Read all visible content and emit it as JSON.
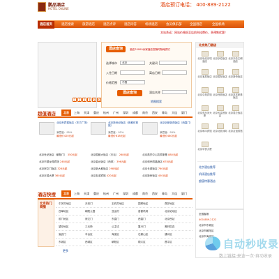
{
  "header": {
    "logo_name": "鹏品酒店",
    "logo_en": "HOTEL ONLINE",
    "hotline": "酒店预订电话：  400-889-2122"
  },
  "nav": {
    "items": [
      "酒店首页",
      "酒店搜索",
      "旅游酒店",
      "酒店点评",
      "酒店问答",
      "机场酒店",
      "会员俱乐部",
      "全国酒店",
      "全国机场"
    ]
  },
  "notice": "本站承诺：网站价格低至店前台挂牌价，多预售优惠！",
  "search": {
    "tab": "酒店查询",
    "slogan": "酒店70000余家酒店您随时随地预订",
    "city_label": "选择城市",
    "city_value": "北京",
    "keyword_label": "关键词",
    "checkin_label": "入住日期",
    "checkout_label": "离店日期",
    "price_label": "价格范围",
    "price_value": "不限",
    "name_label": "酒店名称",
    "button": "酒店查询",
    "map_link": "地图搜索"
  },
  "thumbs": [
    "1",
    "2",
    "3",
    "4",
    "5",
    "6"
  ],
  "sidebar": {
    "title": "北京热门酒店",
    "hotels": [
      "北京世纪京瑞酒店",
      "北京京伦饭店",
      "北京天伦王朝酒店",
      "北京宝辰饭店",
      "北京国际饭店",
      "北京新侨饭店",
      "北京中苑宾馆",
      "北京西苑饭店",
      "北京凯宾斯基饭店",
      "北京亮马河大厦",
      "北京长富宫饭店",
      "北京昆仑饭店",
      "北京和平宾馆",
      "北京北辰洲际",
      "北京友谊宾馆",
      "北京华侨大厦"
    ],
    "links": [
      "北京酒店推荐",
      "机场酒店推荐",
      "超值特惠酒店"
    ]
  },
  "hot": {
    "title": "超值酒店",
    "cities": [
      "北京",
      "上海",
      "天津",
      "重庆",
      "杭州",
      "广州",
      "深圳",
      "成都",
      "南京",
      "西安",
      "青岛",
      "大连",
      "厦门",
      "苏州"
    ],
    "cards": [
      {
        "name": "北京贵宾楼饭店（东方广场）",
        "score": "满意度：95%",
        "price": "最低价420元起"
      },
      {
        "name": "北京新世纪饭店（首都体育馆）",
        "score": "满意度：92%",
        "price": "最低价618元起"
      },
      {
        "name": "北京京都信苑饭店（西直门）",
        "score": "满意度：93%",
        "price": "最低价480元起"
      }
    ],
    "lists": [
      {
        "name": "北京世纪饭店（朝阳门）",
        "price": "350元起"
      },
      {
        "name": "北京国都大饭店（天坛）",
        "price": "268元起"
      },
      {
        "name": "北京燕莎中心凯宾斯基",
        "price": "880元起"
      },
      {
        "name": "北京市银龙苑宾馆",
        "price": "248元起"
      },
      {
        "name": "北京金台饭店（西单）",
        "price": "396元起"
      },
      {
        "name": "北京和乔丽晶酒店",
        "price": "678元起"
      },
      {
        "name": "北京崇文门饭店",
        "price": "328元起"
      },
      {
        "name": "北京新大都饭店",
        "price": "298元起"
      },
      {
        "name": "北京长城饭店",
        "price": "760元起"
      },
      {
        "name": "北京京瑞大厦",
        "price": "360元起"
      },
      {
        "name": "北京友谊宾馆",
        "price": "420元起"
      },
      {
        "name": "北京新侨饭店",
        "price": "450元起"
      }
    ]
  },
  "quick": {
    "title": "酒店快搜",
    "left_header": "北京热门商圈",
    "rows": [
      [
        "中关村地区",
        "天安门",
        "王府井地区",
        "国贸地区",
        "燕莎地区"
      ],
      [
        "西单地区",
        "朝阳公园",
        "亚运村",
        "首都机场",
        "北京站地区"
      ],
      [
        "前门地区",
        "崇文门",
        "东直门",
        "西直门",
        "北京西站"
      ],
      [
        "望京地区",
        "三元桥",
        "公主坟",
        "复兴门",
        "奥林匹克"
      ],
      [
        "宣武门",
        "丰台区",
        "海淀区",
        "石景山区",
        "通州区"
      ],
      [
        "东城区",
        "西城区",
        "朝阳区",
        "顺义区",
        "昌平区"
      ]
    ],
    "more": "更多"
  },
  "sidebar2": {
    "lines": [
      "全国客服",
      "400-889-2122",
      "北京市东城区",
      "北京市朝阳区",
      "北京市海淀区"
    ]
  },
  "watermark": {
    "text": "自动秒收录",
    "sub": "数上链接·来访一次·自动收录"
  }
}
